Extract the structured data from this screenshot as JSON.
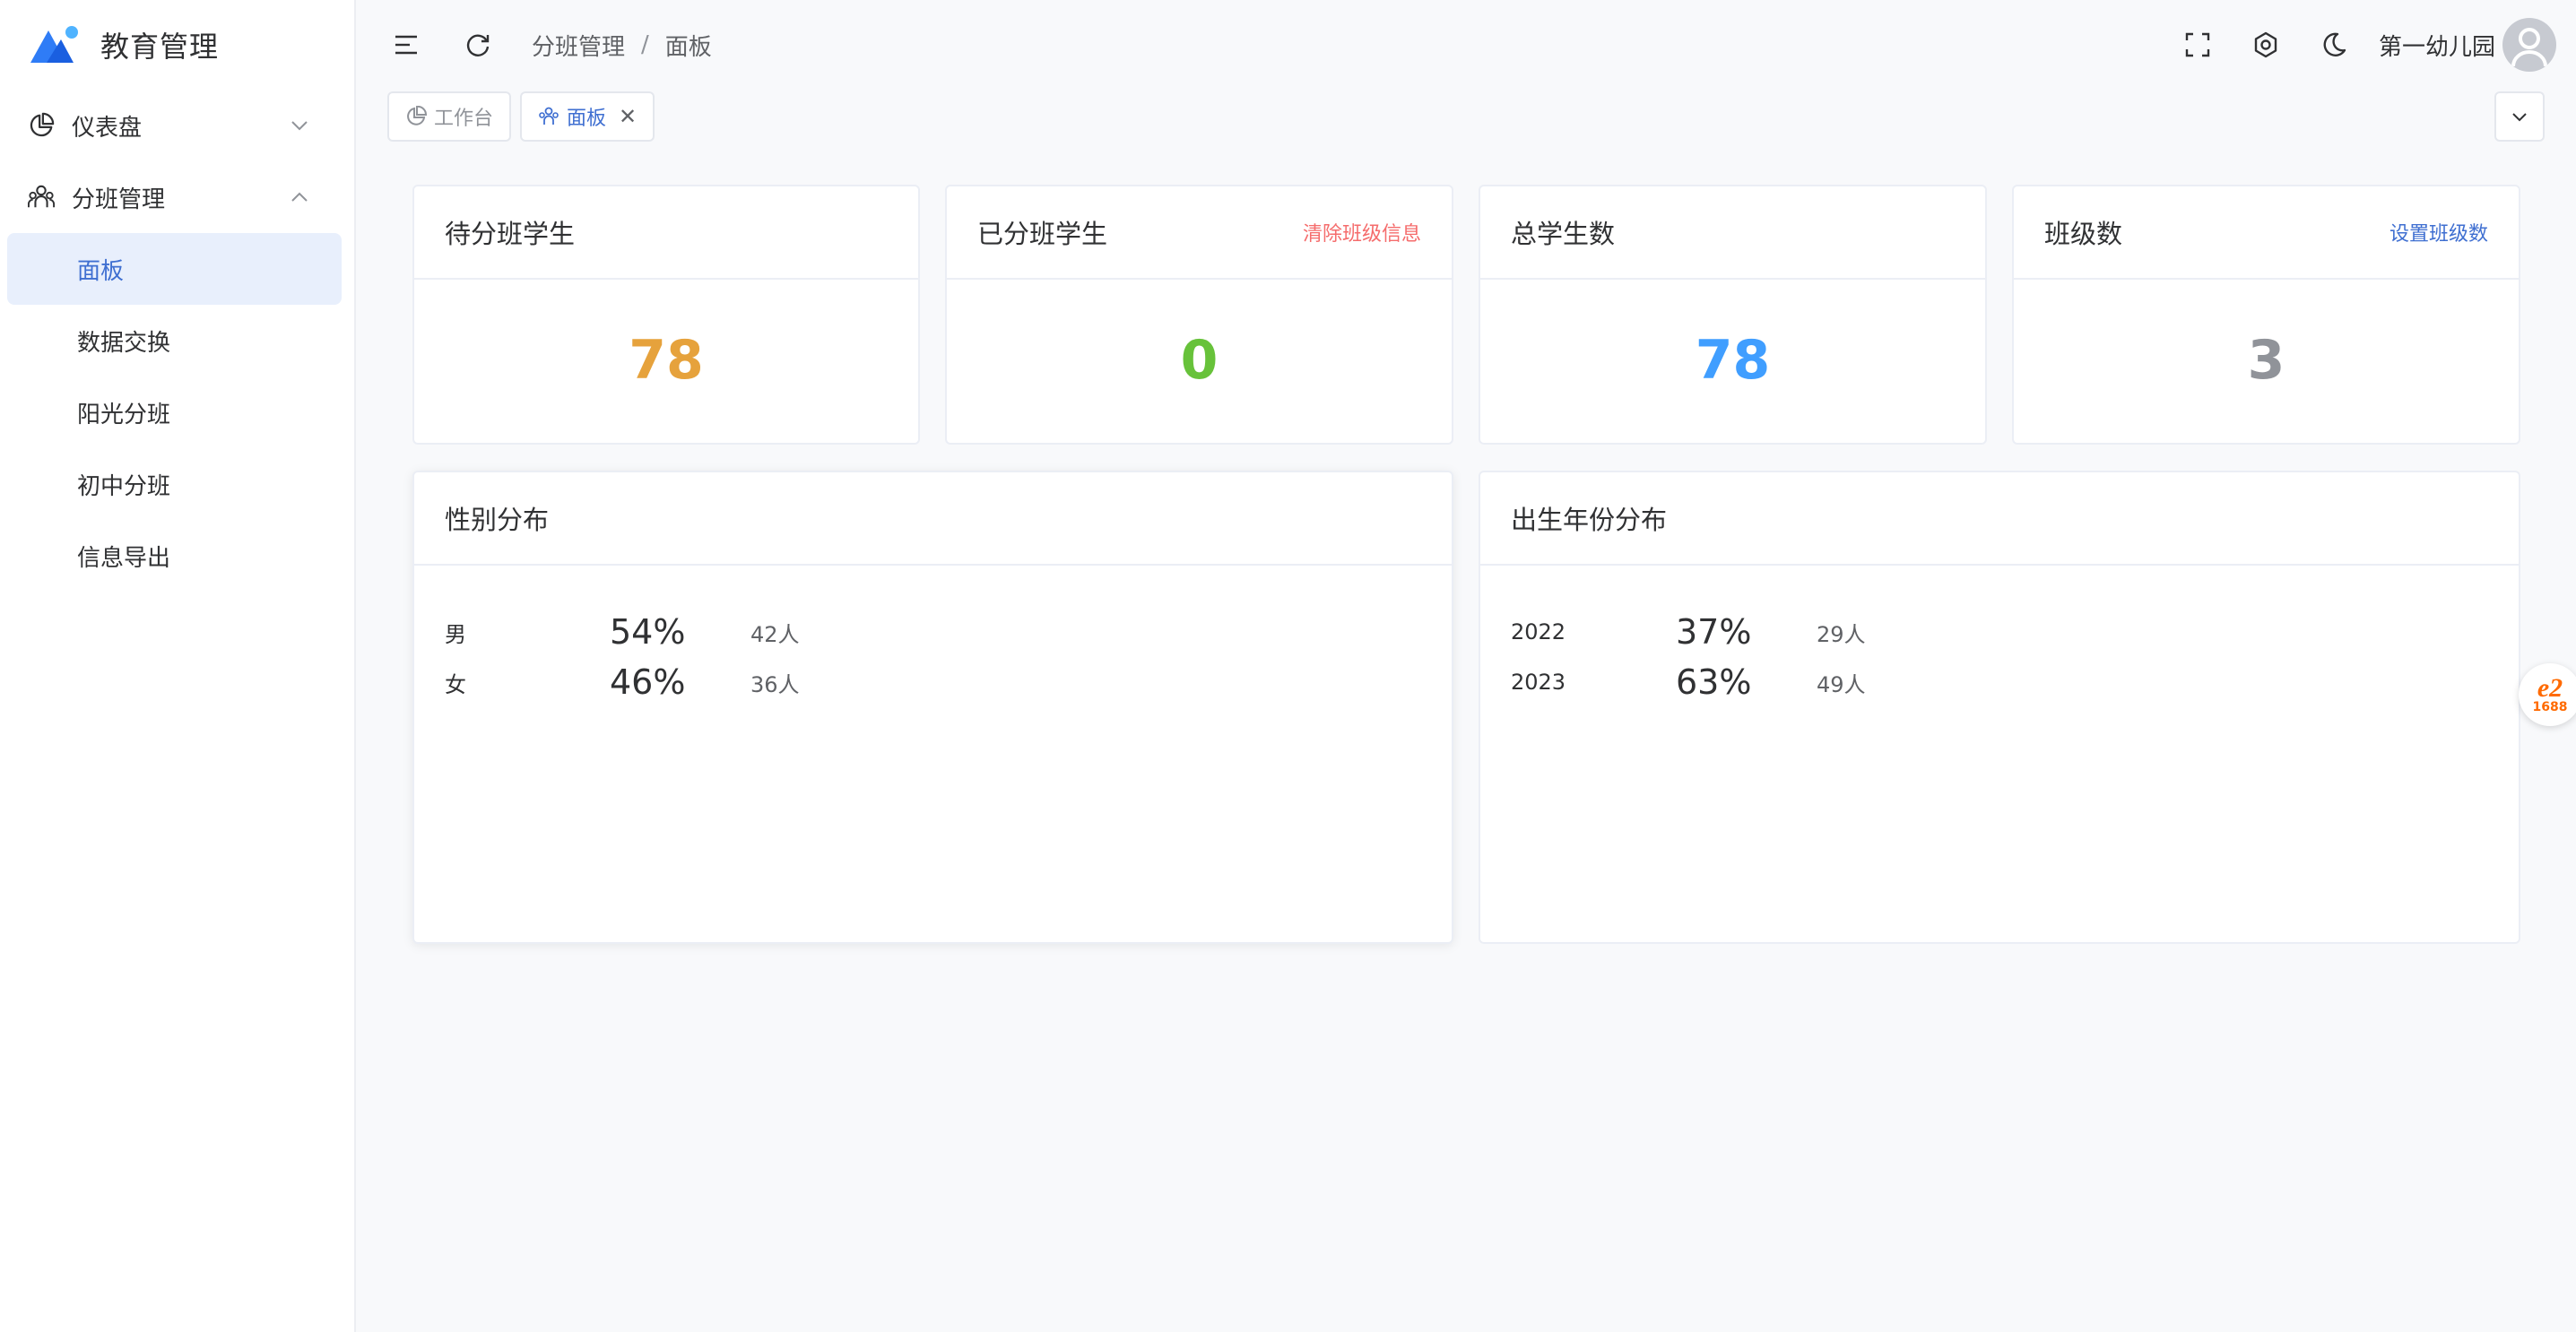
{
  "app": {
    "title": "教育管理"
  },
  "sidebar": {
    "menus": [
      {
        "label": "仪表盘",
        "expanded": false
      },
      {
        "label": "分班管理",
        "expanded": true
      }
    ],
    "sub_items": [
      {
        "label": "面板",
        "active": true
      },
      {
        "label": "数据交换",
        "active": false
      },
      {
        "label": "阳光分班",
        "active": false
      },
      {
        "label": "初中分班",
        "active": false
      },
      {
        "label": "信息导出",
        "active": false
      }
    ]
  },
  "header": {
    "breadcrumb": [
      "分班管理",
      "面板"
    ],
    "breadcrumb_sep": "/",
    "org_name": "第一幼儿园"
  },
  "tabs": [
    {
      "label": "工作台",
      "icon": "pie-chart-icon",
      "active": false
    },
    {
      "label": "面板",
      "icon": "people-icon",
      "active": true,
      "close": "✕"
    }
  ],
  "stats": [
    {
      "title": "待分班学生",
      "value": "78",
      "color": "#e6a23c"
    },
    {
      "title": "已分班学生",
      "value": "0",
      "color": "#67c23a",
      "link": "清除班级信息",
      "link_color": "#f56c6c"
    },
    {
      "title": "总学生数",
      "value": "78",
      "color": "#409eff"
    },
    {
      "title": "班级数",
      "value": "3",
      "color": "#909399",
      "link": "设置班级数",
      "link_color": "#3f6fd1"
    }
  ],
  "gender": {
    "title": "性别分布",
    "rows": [
      {
        "label": "男",
        "percent": "54%",
        "count": "42人"
      },
      {
        "label": "女",
        "percent": "46%",
        "count": "36人"
      }
    ]
  },
  "birth_year": {
    "title": "出生年份分布",
    "rows": [
      {
        "label": "2022",
        "percent": "37%",
        "count": "29人"
      },
      {
        "label": "2023",
        "percent": "63%",
        "count": "49人"
      }
    ]
  },
  "badge": {
    "brand": "e2",
    "code": "1688"
  },
  "colors": {
    "primary": "#3f6fd1",
    "active_bg": "#e8effc"
  }
}
